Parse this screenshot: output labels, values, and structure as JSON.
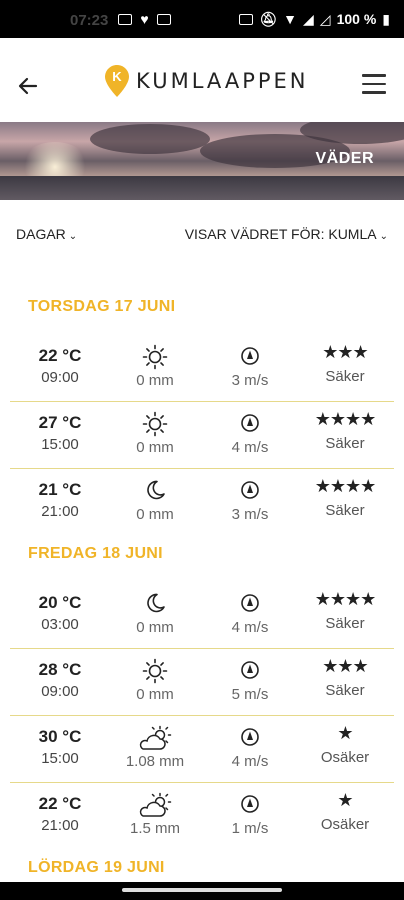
{
  "status": {
    "time": "07:23",
    "battery": "100 %"
  },
  "header": {
    "app_name": "KUMLAAPPEN",
    "logo_letter": "K"
  },
  "hero": {
    "label": "VÄDER"
  },
  "filters": {
    "period_label": "DAGAR",
    "location_label": "VISAR VÄDRET FÖR: KUMLA"
  },
  "colors": {
    "accent": "#f0b428",
    "divider": "#e6d98a"
  },
  "days": [
    {
      "title": "TORSDAG 17 JUNI",
      "rows": [
        {
          "temp": "22 °C",
          "time": "09:00",
          "precip_icon": "sun-icon",
          "precip": "0 mm",
          "wind_icon": "wind-direction-icon",
          "wind": "3 m/s",
          "stars": "★★★",
          "reliability": "Säker"
        },
        {
          "temp": "27 °C",
          "time": "15:00",
          "precip_icon": "sun-icon",
          "precip": "0 mm",
          "wind_icon": "wind-direction-icon",
          "wind": "4 m/s",
          "stars": "★★★★",
          "reliability": "Säker"
        },
        {
          "temp": "21 °C",
          "time": "21:00",
          "precip_icon": "moon-icon",
          "precip": "0 mm",
          "wind_icon": "wind-direction-icon",
          "wind": "3 m/s",
          "stars": "★★★★",
          "reliability": "Säker"
        }
      ]
    },
    {
      "title": "FREDAG 18 JUNI",
      "rows": [
        {
          "temp": "20 °C",
          "time": "03:00",
          "precip_icon": "moon-icon",
          "precip": "0 mm",
          "wind_icon": "wind-direction-icon",
          "wind": "4 m/s",
          "stars": "★★★★",
          "reliability": "Säker"
        },
        {
          "temp": "28 °C",
          "time": "09:00",
          "precip_icon": "sun-icon",
          "precip": "0 mm",
          "wind_icon": "wind-direction-icon",
          "wind": "5 m/s",
          "stars": "★★★",
          "reliability": "Säker"
        },
        {
          "temp": "30 °C",
          "time": "15:00",
          "precip_icon": "sun-cloud-icon",
          "precip": "1.08 mm",
          "wind_icon": "wind-direction-icon",
          "wind": "4 m/s",
          "stars": "★",
          "reliability": "Osäker"
        },
        {
          "temp": "22 °C",
          "time": "21:00",
          "precip_icon": "sun-cloud-icon",
          "precip": "1.5 mm",
          "wind_icon": "wind-direction-icon",
          "wind": "1 m/s",
          "stars": "★",
          "reliability": "Osäker"
        }
      ]
    },
    {
      "title": "LÖRDAG 19 JUNI",
      "rows": []
    }
  ]
}
